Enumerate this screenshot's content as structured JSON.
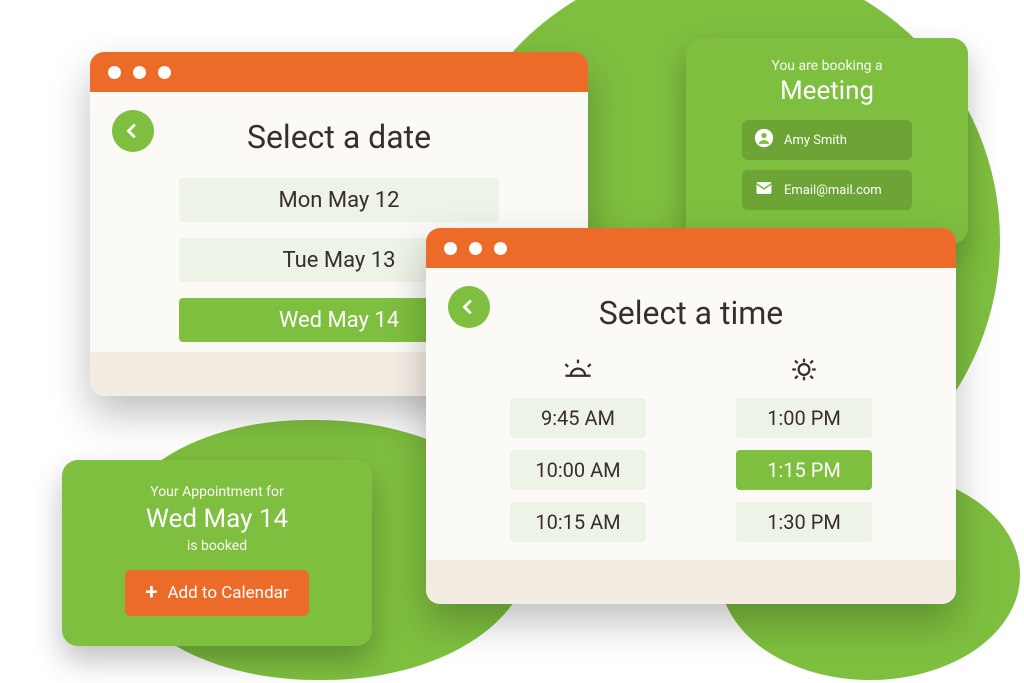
{
  "date_window": {
    "title": "Select a date",
    "options": [
      "Mon May 12",
      "Tue May 13",
      "Wed May 14"
    ],
    "selected_index": 2
  },
  "time_window": {
    "title": "Select a time",
    "morning": [
      "9:45 AM",
      "10:00 AM",
      "10:15 AM"
    ],
    "afternoon": [
      "1:00 PM",
      "1:15 PM",
      "1:30 PM"
    ],
    "selected": "1:15 PM"
  },
  "booking_card": {
    "sub": "You are booking a",
    "title": "Meeting",
    "user_name": "Amy Smith",
    "user_email": "Email@mail.com"
  },
  "confirm_card": {
    "sub": "Your Appointment for",
    "date": "Wed May 14",
    "booked": "is booked",
    "add_cal": "Add to Calendar"
  }
}
